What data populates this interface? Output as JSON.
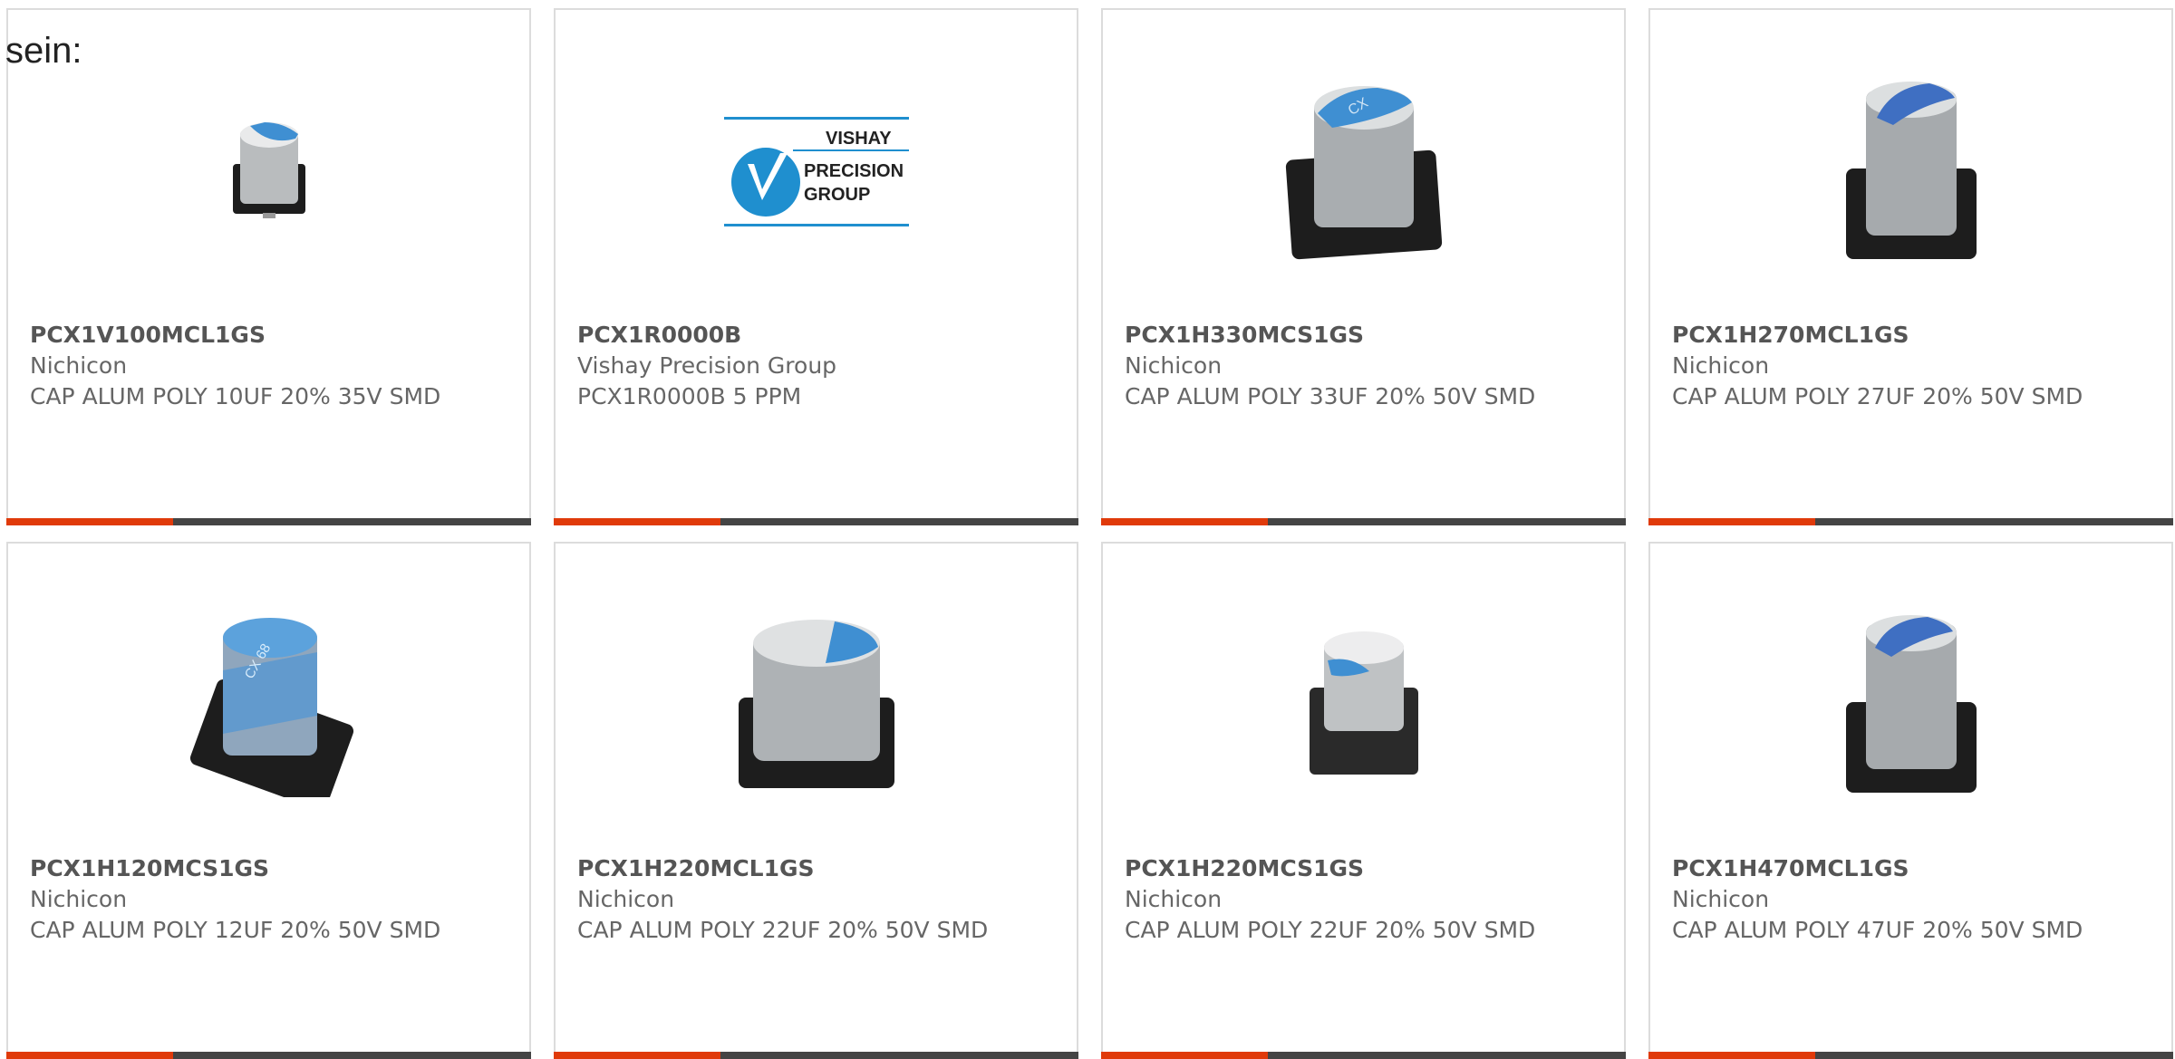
{
  "lead_text": "sein:",
  "cards": [
    {
      "part": "PCX1V100MCL1GS",
      "mfr": "Nichicon",
      "desc": "CAP ALUM POLY 10UF 20% 35V SMD",
      "image": "capacitor-small-icon"
    },
    {
      "part": "PCX1R0000B",
      "mfr": "Vishay Precision Group",
      "desc": "PCX1R0000B 5 PPM",
      "image": "vishay-logo",
      "logo": {
        "line1": "VISHAY",
        "line2": "PRECISION",
        "line3": "GROUP"
      }
    },
    {
      "part": "PCX1H330MCS1GS",
      "mfr": "Nichicon",
      "desc": "CAP ALUM POLY 33UF 20% 50V SMD",
      "image": "capacitor-cx-icon"
    },
    {
      "part": "PCX1H270MCL1GS",
      "mfr": "Nichicon",
      "desc": "CAP ALUM POLY 27UF 20% 50V SMD",
      "image": "capacitor-tall-icon"
    },
    {
      "part": "PCX1H120MCS1GS",
      "mfr": "Nichicon",
      "desc": "CAP ALUM POLY 12UF 20% 50V SMD",
      "image": "capacitor-blue-icon"
    },
    {
      "part": "PCX1H220MCL1GS",
      "mfr": "Nichicon",
      "desc": "CAP ALUM POLY 22UF 20% 50V SMD",
      "image": "capacitor-wide-icon"
    },
    {
      "part": "PCX1H220MCS1GS",
      "mfr": "Nichicon",
      "desc": "CAP ALUM POLY 22UF 20% 50V SMD",
      "image": "capacitor-small-icon"
    },
    {
      "part": "PCX1H470MCL1GS",
      "mfr": "Nichicon",
      "desc": "CAP ALUM POLY 47UF 20% 50V SMD",
      "image": "capacitor-tall-icon"
    }
  ],
  "colors": {
    "accent": "#e03a0a",
    "bar": "#444444",
    "cap_blue": "#3f8fd2",
    "cap_silver": "#b9bcbe",
    "base": "#1d1d1d",
    "vishay_blue": "#1f8fcf"
  }
}
